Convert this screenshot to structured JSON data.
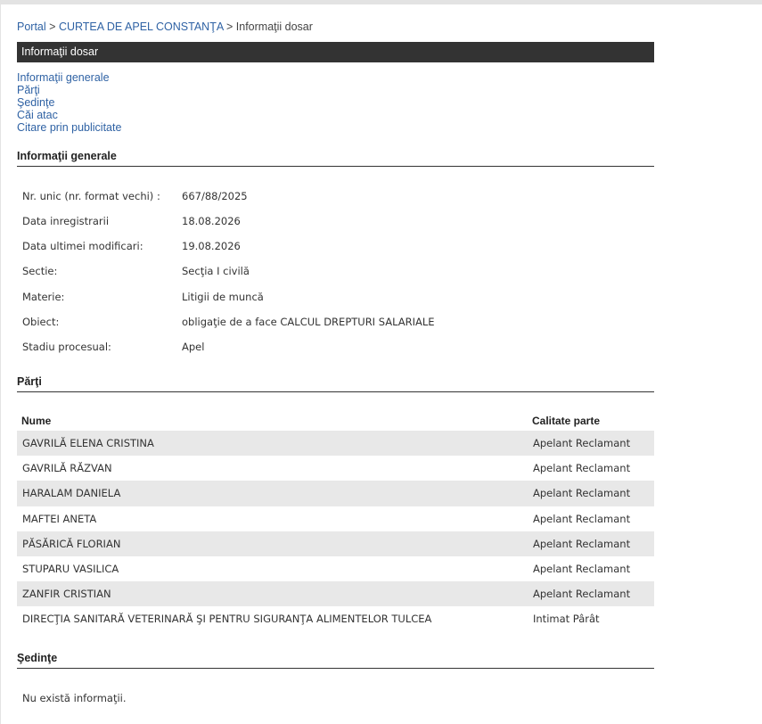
{
  "breadcrumb": {
    "portal": "Portal",
    "sep": ">",
    "court": "CURTEA DE APEL CONSTANŢA",
    "current": "Informaţii dosar"
  },
  "title": "Informaţii dosar",
  "nav": [
    "Informaţii generale",
    "Părţi",
    "Şedinţe",
    "Căi atac",
    "Citare prin publicitate"
  ],
  "general": {
    "heading": "Informaţii generale",
    "rows": [
      {
        "label": "Nr. unic (nr. format vechi) :",
        "value": "667/88/2025"
      },
      {
        "label": "Data inregistrarii",
        "value": "18.08.2026"
      },
      {
        "label": "Data ultimei modificari:",
        "value": "19.08.2026"
      },
      {
        "label": "Sectie:",
        "value": "Secţia I civilă"
      },
      {
        "label": "Materie:",
        "value": "Litigii de muncă"
      },
      {
        "label": "Obiect:",
        "value": "obligaţie de a face CALCUL DREPTURI SALARIALE"
      },
      {
        "label": "Stadiu procesual:",
        "value": "Apel"
      }
    ]
  },
  "parti": {
    "heading": "Părţi",
    "col_name": "Nume",
    "col_role": "Calitate parte",
    "rows": [
      {
        "name": "GAVRILĂ ELENA CRISTINA",
        "role": "Apelant Reclamant"
      },
      {
        "name": "GAVRILĂ RĂZVAN",
        "role": "Apelant Reclamant"
      },
      {
        "name": "HARALAM DANIELA",
        "role": "Apelant Reclamant"
      },
      {
        "name": "MAFTEI ANETA",
        "role": "Apelant Reclamant"
      },
      {
        "name": "PĂSĂRICĂ FLORIAN",
        "role": "Apelant Reclamant"
      },
      {
        "name": "STUPARU VASILICA",
        "role": "Apelant Reclamant"
      },
      {
        "name": "ZANFIR CRISTIAN",
        "role": "Apelant Reclamant"
      },
      {
        "name": "DIRECŢIA SANITARĂ VETERINARĂ ŞI PENTRU SIGURANŢA ALIMENTELOR TULCEA",
        "role": "Intimat Pârât"
      }
    ]
  },
  "sedinte": {
    "heading": "Şedinţe",
    "empty": "Nu există informaţii."
  }
}
